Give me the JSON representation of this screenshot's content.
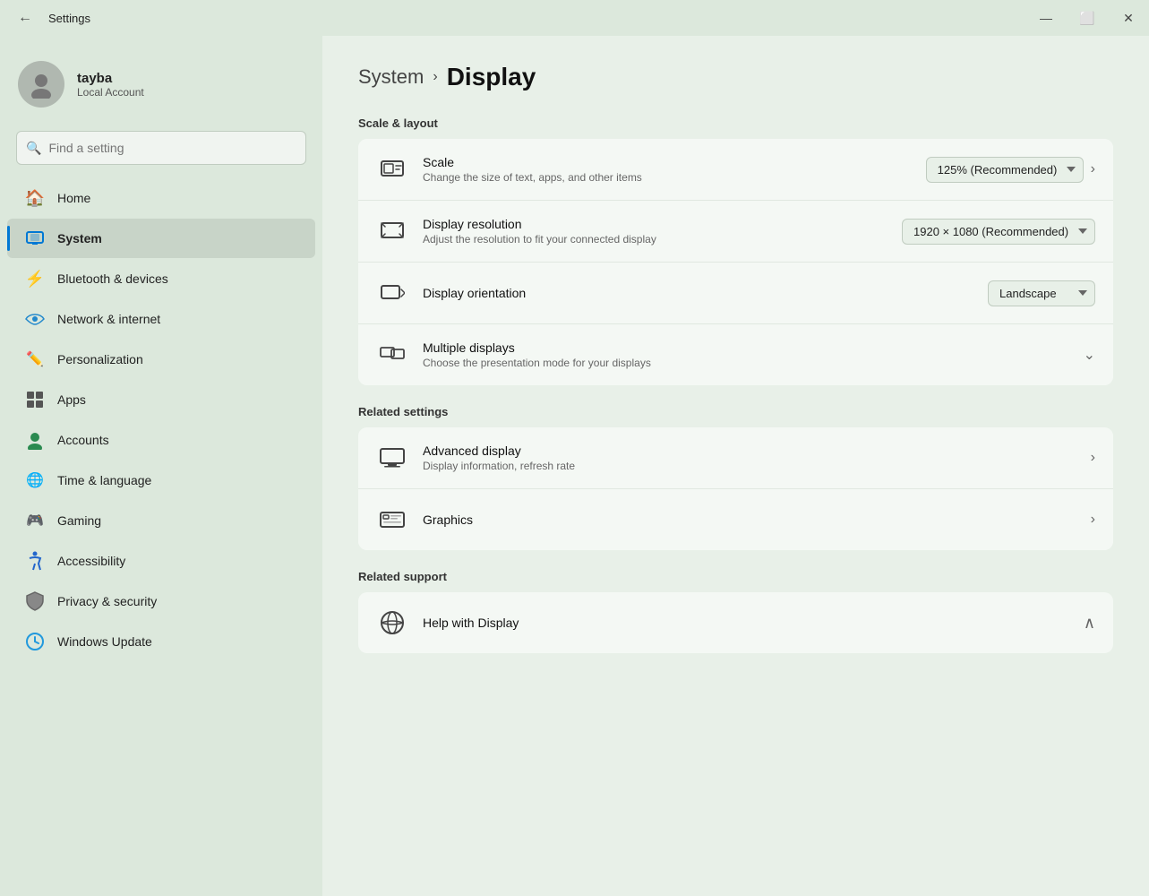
{
  "window": {
    "title": "Settings",
    "controls": {
      "minimize": "—",
      "maximize": "⬜",
      "close": "✕"
    }
  },
  "sidebar": {
    "user": {
      "name": "tayba",
      "account_type": "Local Account"
    },
    "search_placeholder": "Find a setting",
    "nav_items": [
      {
        "id": "home",
        "label": "Home",
        "icon": "🏠"
      },
      {
        "id": "system",
        "label": "System",
        "icon": "💻",
        "active": true
      },
      {
        "id": "bluetooth",
        "label": "Bluetooth & devices",
        "icon": "🔵"
      },
      {
        "id": "network",
        "label": "Network & internet",
        "icon": "📶"
      },
      {
        "id": "personalization",
        "label": "Personalization",
        "icon": "🖌"
      },
      {
        "id": "apps",
        "label": "Apps",
        "icon": "🟦"
      },
      {
        "id": "accounts",
        "label": "Accounts",
        "icon": "👤"
      },
      {
        "id": "time",
        "label": "Time & language",
        "icon": "🌐"
      },
      {
        "id": "gaming",
        "label": "Gaming",
        "icon": "🎮"
      },
      {
        "id": "accessibility",
        "label": "Accessibility",
        "icon": "♿"
      },
      {
        "id": "privacy",
        "label": "Privacy & security",
        "icon": "🛡"
      },
      {
        "id": "windows_update",
        "label": "Windows Update",
        "icon": "🔄"
      }
    ]
  },
  "content": {
    "breadcrumb": {
      "parent": "System",
      "current": "Display"
    },
    "scale_layout": {
      "header": "Scale & layout",
      "rows": [
        {
          "id": "scale",
          "icon": "scale",
          "title": "Scale",
          "subtitle": "Change the size of text, apps, and other items",
          "control_type": "dropdown_chevron",
          "value": "125% (Recommended)"
        },
        {
          "id": "resolution",
          "icon": "resolution",
          "title": "Display resolution",
          "subtitle": "Adjust the resolution to fit your connected display",
          "control_type": "dropdown",
          "value": "1920 × 1080 (Recommended)"
        },
        {
          "id": "orientation",
          "icon": "orientation",
          "title": "Display orientation",
          "subtitle": "",
          "control_type": "dropdown",
          "value": "Landscape"
        },
        {
          "id": "multiple",
          "icon": "multiple",
          "title": "Multiple displays",
          "subtitle": "Choose the presentation mode for your displays",
          "control_type": "chevron_down",
          "value": ""
        }
      ]
    },
    "related_settings": {
      "header": "Related settings",
      "rows": [
        {
          "id": "advanced_display",
          "icon": "monitor",
          "title": "Advanced display",
          "subtitle": "Display information, refresh rate",
          "control_type": "chevron_right",
          "has_arrow": true
        },
        {
          "id": "graphics",
          "icon": "graphics",
          "title": "Graphics",
          "subtitle": "",
          "control_type": "chevron_right",
          "has_arrow": false
        }
      ]
    },
    "related_support": {
      "header": "Related support",
      "rows": [
        {
          "id": "help_display",
          "icon": "globe",
          "title": "Help with Display",
          "subtitle": "",
          "control_type": "chevron_up"
        }
      ]
    }
  }
}
